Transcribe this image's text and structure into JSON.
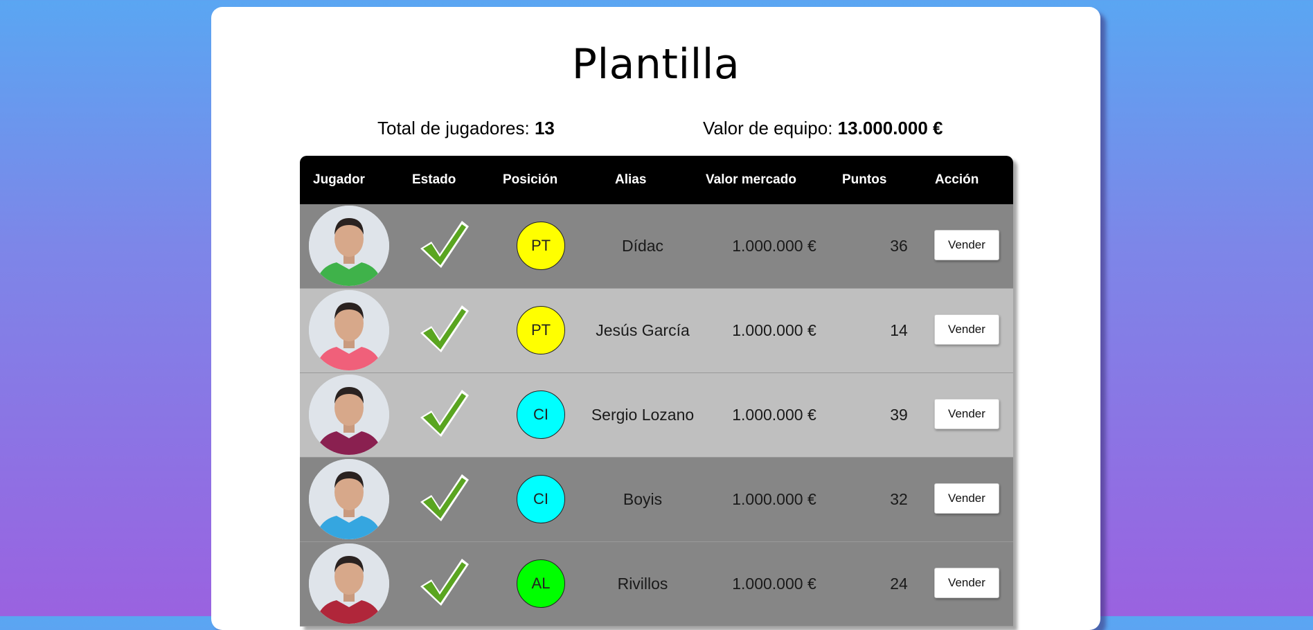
{
  "page": {
    "title": "Plantilla"
  },
  "stats": {
    "players_label": "Total de jugadores: ",
    "players_value": "13",
    "value_label": "Valor de equipo: ",
    "value_value": "13.000.000 €"
  },
  "table": {
    "headers": [
      "Jugador",
      "Estado",
      "Posición",
      "Alias",
      "Valor mercado",
      "Puntos",
      "Acción"
    ],
    "rows": [
      {
        "alias": "Dídac",
        "position": "PT",
        "position_color": "#ffff00",
        "market_value": "1.000.000 €",
        "points": "36",
        "status": "check-icon",
        "action": "Vender",
        "shirt_color": "#3fb24a",
        "bg": "dark"
      },
      {
        "alias": "Jesús García",
        "position": "PT",
        "position_color": "#ffff00",
        "market_value": "1.000.000 €",
        "points": "14",
        "status": "check-icon",
        "action": "Vender",
        "shirt_color": "#f0607a",
        "bg": "light"
      },
      {
        "alias": "Sergio Lozano",
        "position": "CI",
        "position_color": "#00ffff",
        "market_value": "1.000.000 €",
        "points": "39",
        "status": "check-icon",
        "action": "Vender",
        "shirt_color": "#8a2050",
        "bg": "light"
      },
      {
        "alias": "Boyis",
        "position": "CI",
        "position_color": "#00ffff",
        "market_value": "1.000.000 €",
        "points": "32",
        "status": "check-icon",
        "action": "Vender",
        "shirt_color": "#35a6e0",
        "bg": "dark"
      },
      {
        "alias": "Rivillos",
        "position": "AL",
        "position_color": "#00ff00",
        "market_value": "1.000.000 €",
        "points": "24",
        "status": "check-icon",
        "action": "Vender",
        "shirt_color": "#b0263a",
        "bg": "dark"
      }
    ]
  },
  "colors": {
    "header_bg": "#000000",
    "row_dark": "#868686",
    "row_light": "#bfbfbf",
    "check": "#5aa520"
  }
}
